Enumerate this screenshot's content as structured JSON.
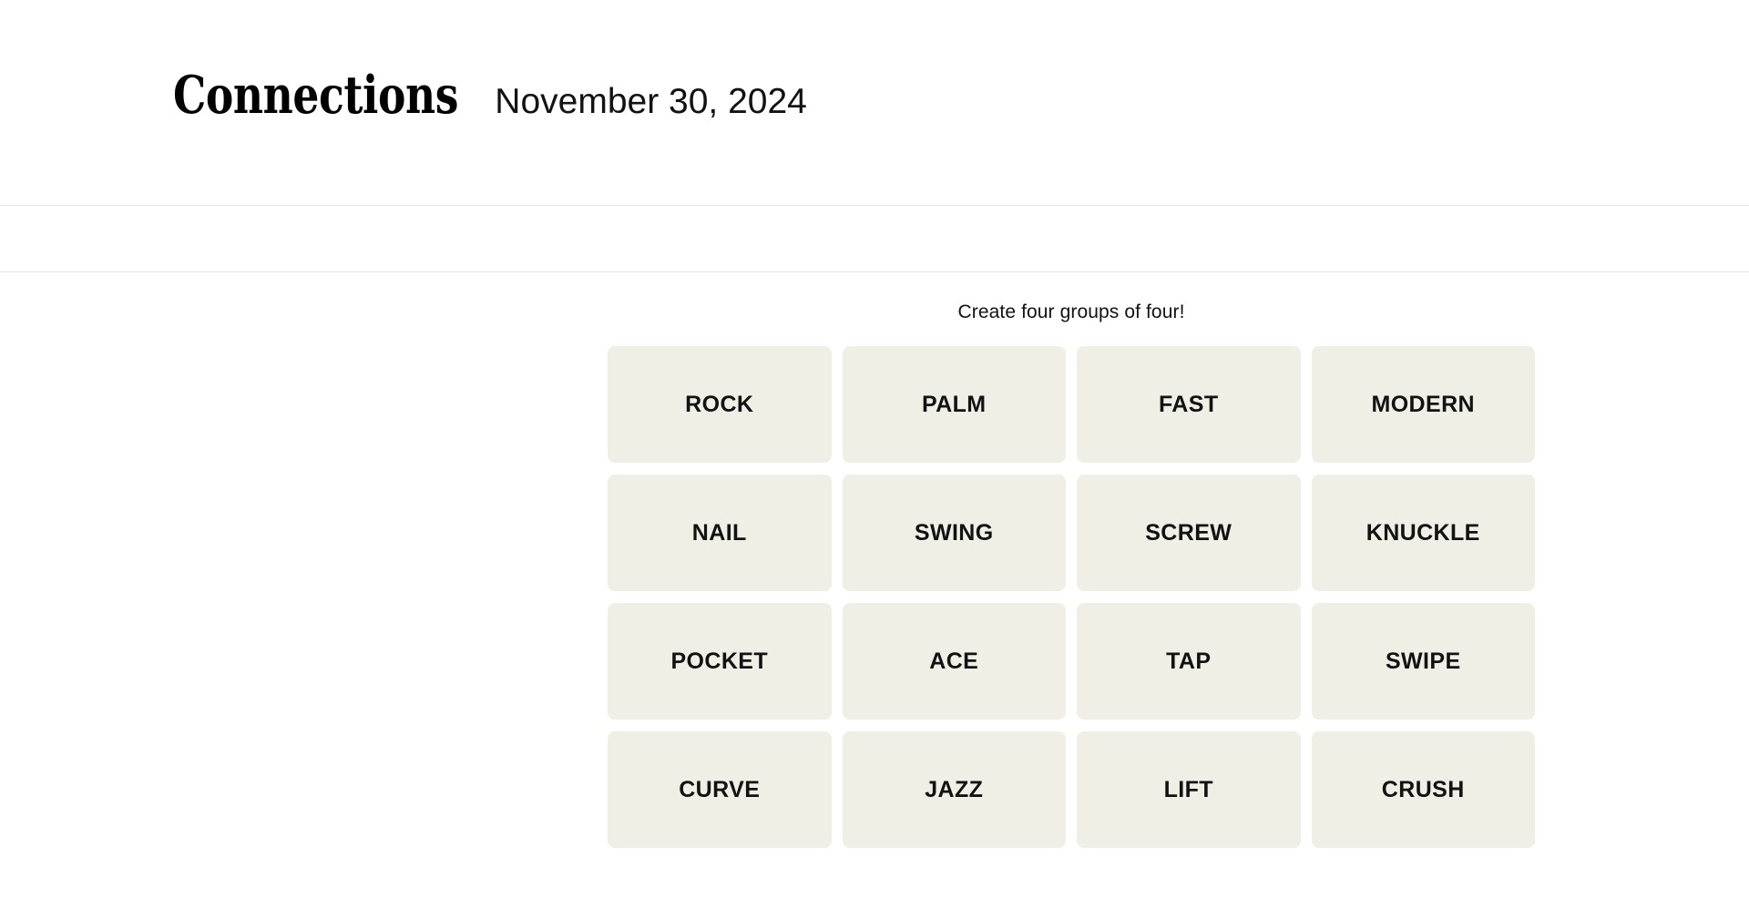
{
  "masthead": {
    "title": "Connections",
    "date": "November 30, 2024"
  },
  "board": {
    "instruction": "Create four groups of four!",
    "tiles": [
      "ROCK",
      "PALM",
      "FAST",
      "MODERN",
      "NAIL",
      "SWING",
      "SCREW",
      "KNUCKLE",
      "POCKET",
      "ACE",
      "TAP",
      "SWIPE",
      "CURVE",
      "JAZZ",
      "LIFT",
      "CRUSH"
    ]
  },
  "colors": {
    "tile_background": "#efefe6",
    "page_background": "#ffffff",
    "text": "#121212",
    "rule": "#e6e6e6"
  }
}
